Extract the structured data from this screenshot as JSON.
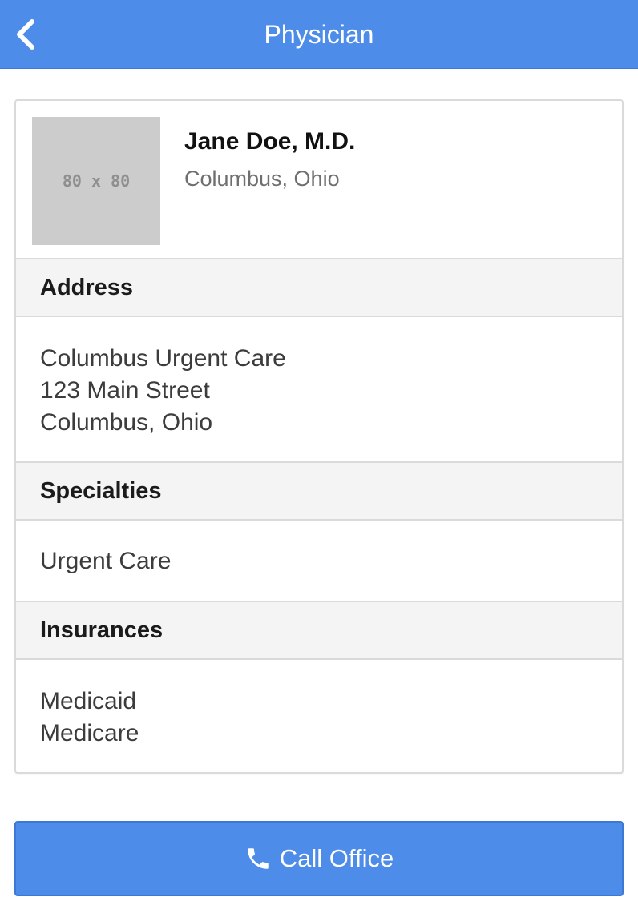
{
  "header": {
    "title": "Physician",
    "back_icon": "chevron-left-icon"
  },
  "physician": {
    "photo_placeholder": "80 x 80",
    "name": "Jane Doe, M.D.",
    "location": "Columbus, Ohio"
  },
  "sections": {
    "address": {
      "title": "Address",
      "lines": [
        "Columbus Urgent Care",
        "123 Main Street",
        "Columbus, Ohio"
      ]
    },
    "specialties": {
      "title": "Specialties",
      "lines": [
        "Urgent Care"
      ]
    },
    "insurances": {
      "title": "Insurances",
      "lines": [
        "Medicaid",
        "Medicare"
      ]
    }
  },
  "actions": {
    "call_label": "Call Office",
    "call_icon": "phone-icon"
  },
  "colors": {
    "accent": "#4d8ce8",
    "section_bg": "#f4f4f4",
    "border": "#dadada"
  }
}
